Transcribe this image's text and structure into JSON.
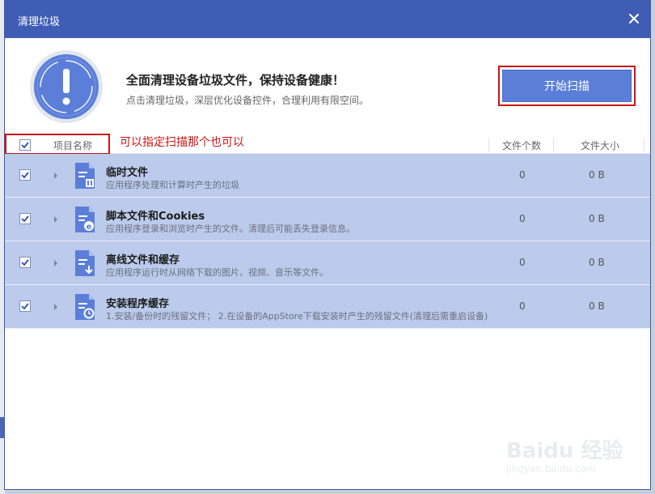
{
  "window": {
    "title": "清理垃圾"
  },
  "header": {
    "headline": "全面清理设备垃圾文件，保持设备健康！",
    "subline": "点击清理垃圾，深层优化设备控件，合理利用有限空间。",
    "scan_button": "开始扫描"
  },
  "columns": {
    "name": "项目名称",
    "annotation": "可以指定扫描那个也可以",
    "count": "文件个数",
    "size": "文件大小"
  },
  "items": [
    {
      "title": "临时文件",
      "desc": "应用程序处理和计算时产生的垃圾",
      "count": "0",
      "size": "0 B",
      "checked": true,
      "icon": "temp-file-icon"
    },
    {
      "title": "脚本文件和Cookies",
      "desc": "应用程序登录和浏览时产生的文件。清理后可能丢失登录信息。",
      "count": "0",
      "size": "0 B",
      "checked": true,
      "icon": "script-file-icon"
    },
    {
      "title": "离线文件和缓存",
      "desc": "应用程序运行时从网络下载的图片、视频、音乐等文件。",
      "count": "0",
      "size": "0 B",
      "checked": true,
      "icon": "cache-file-icon"
    },
    {
      "title": "安装程序缓存",
      "desc": "1.安装/备份时的残留文件； 2.在设备的AppStore下载安装时产生的残留文件(清理后需重启设备)",
      "count": "0",
      "size": "0 B",
      "checked": true,
      "icon": "installer-cache-icon"
    }
  ],
  "watermark": {
    "main": "Baidu 经验",
    "sub": "jingyan.baidu.com"
  },
  "colors": {
    "titlebar": "#3f5db5",
    "row_bg": "#bccbec",
    "accent": "#5b7ed9",
    "annotation": "#cc1414"
  }
}
